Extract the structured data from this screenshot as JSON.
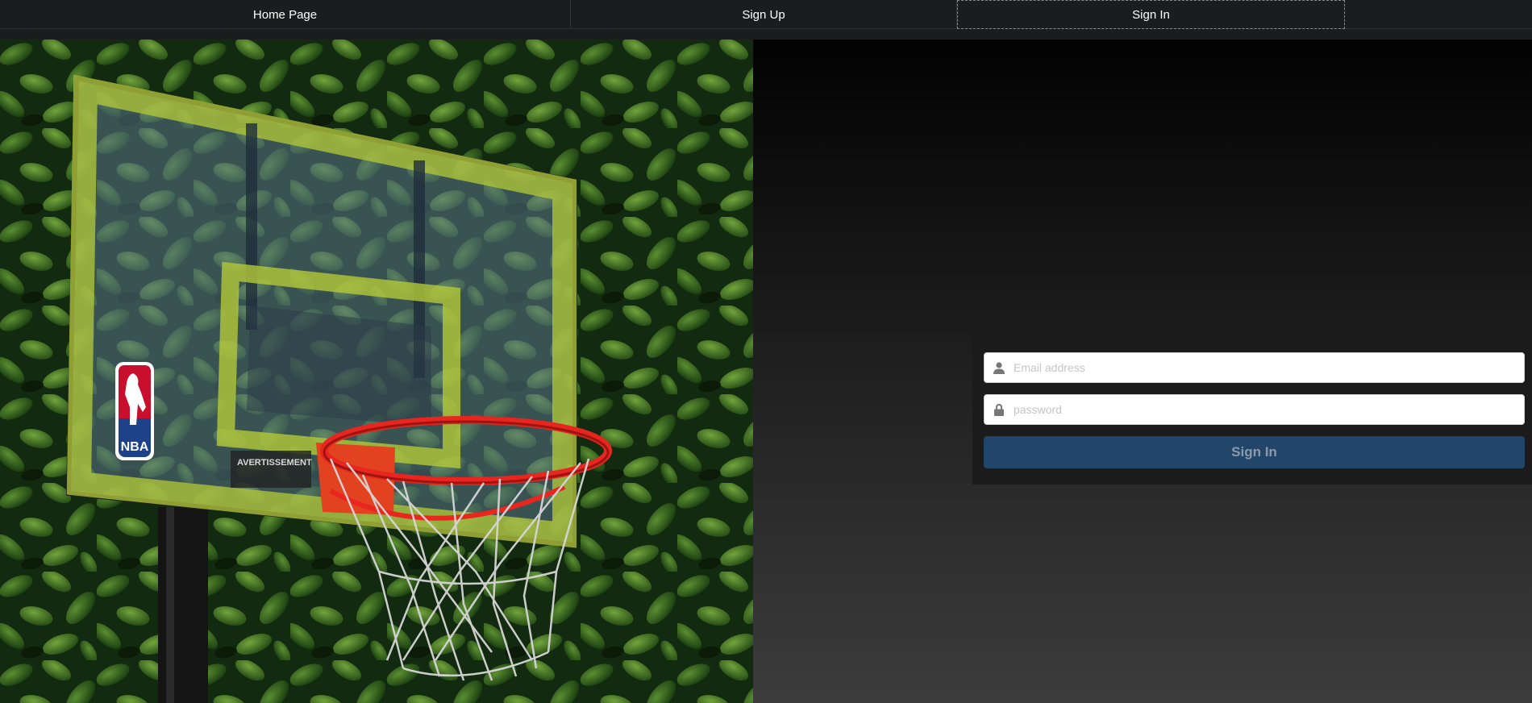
{
  "nav": {
    "items": [
      {
        "label": "Home Page"
      },
      {
        "label": "Sign Up"
      },
      {
        "label": "Sign In"
      }
    ],
    "active": "Sign In"
  },
  "hero": {
    "image": "basketball-hoop-photo",
    "backboard_logo_text": "NBA",
    "warning_text": "AVERTISSEMENT"
  },
  "login": {
    "email_placeholder": "Email address",
    "password_placeholder": "password",
    "submit_label": "Sign In",
    "email_icon": "user-icon",
    "password_icon": "lock-icon"
  },
  "colors": {
    "menu_bg": "#1b1c1d",
    "button_primary": "#21466a",
    "rim": "#e8261f",
    "board_frame": "#b4c93a"
  }
}
